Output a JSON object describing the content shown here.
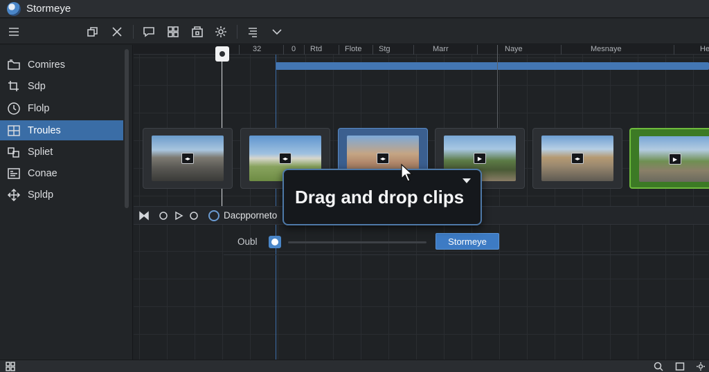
{
  "app": {
    "title": "Stormeye",
    "logo_icon": "app-logo-icon"
  },
  "toolbar": {
    "buttons": [
      {
        "icon": "menu-icon"
      },
      {
        "icon": "duplicate-icon"
      },
      {
        "icon": "close-icon"
      },
      {
        "icon": "comment-icon"
      },
      {
        "icon": "grid-icon"
      },
      {
        "icon": "layers-icon"
      },
      {
        "icon": "gear-icon"
      },
      {
        "icon": "align-icon"
      },
      {
        "icon": "chevron-down-icon"
      }
    ]
  },
  "sidebar": {
    "items": [
      {
        "label": "Comires",
        "icon": "folder-icon",
        "active": false
      },
      {
        "label": "Sdp",
        "icon": "crop-icon",
        "active": false
      },
      {
        "label": "Flolp",
        "icon": "clock-icon",
        "active": false
      },
      {
        "label": "Troules",
        "icon": "grid-icon",
        "active": true
      },
      {
        "label": "Spliet",
        "icon": "split-icon",
        "active": false
      },
      {
        "label": "Conae",
        "icon": "list-icon",
        "active": false
      },
      {
        "label": "Spldp",
        "icon": "move-icon",
        "active": false
      }
    ]
  },
  "ruler": {
    "labels": [
      "32",
      "0",
      "Rtd",
      "Flote",
      "Stg",
      "Marr",
      "Naye",
      "Mesnaye",
      "He"
    ]
  },
  "clips": [
    {
      "name": "clip-1",
      "state": "normal",
      "badge": "◂▸"
    },
    {
      "name": "clip-2",
      "state": "normal",
      "badge": "◂▸"
    },
    {
      "name": "clip-3",
      "state": "selected",
      "badge": "◂▸"
    },
    {
      "name": "clip-4",
      "state": "normal",
      "badge": "▶"
    },
    {
      "name": "clip-5",
      "state": "normal",
      "badge": "◂▸"
    },
    {
      "name": "clip-6",
      "state": "highlight",
      "badge": "▶"
    }
  ],
  "track": {
    "name": "Dacpporneto",
    "slider_label": "Oubl",
    "slider_value": 0,
    "action_label": "Stormeye"
  },
  "tooltip": {
    "text": "Drag and drop clips"
  },
  "colors": {
    "accent": "#3d7bc4",
    "active_sidebar": "#3a6da6",
    "highlight_clip": "#6fbb3d"
  }
}
